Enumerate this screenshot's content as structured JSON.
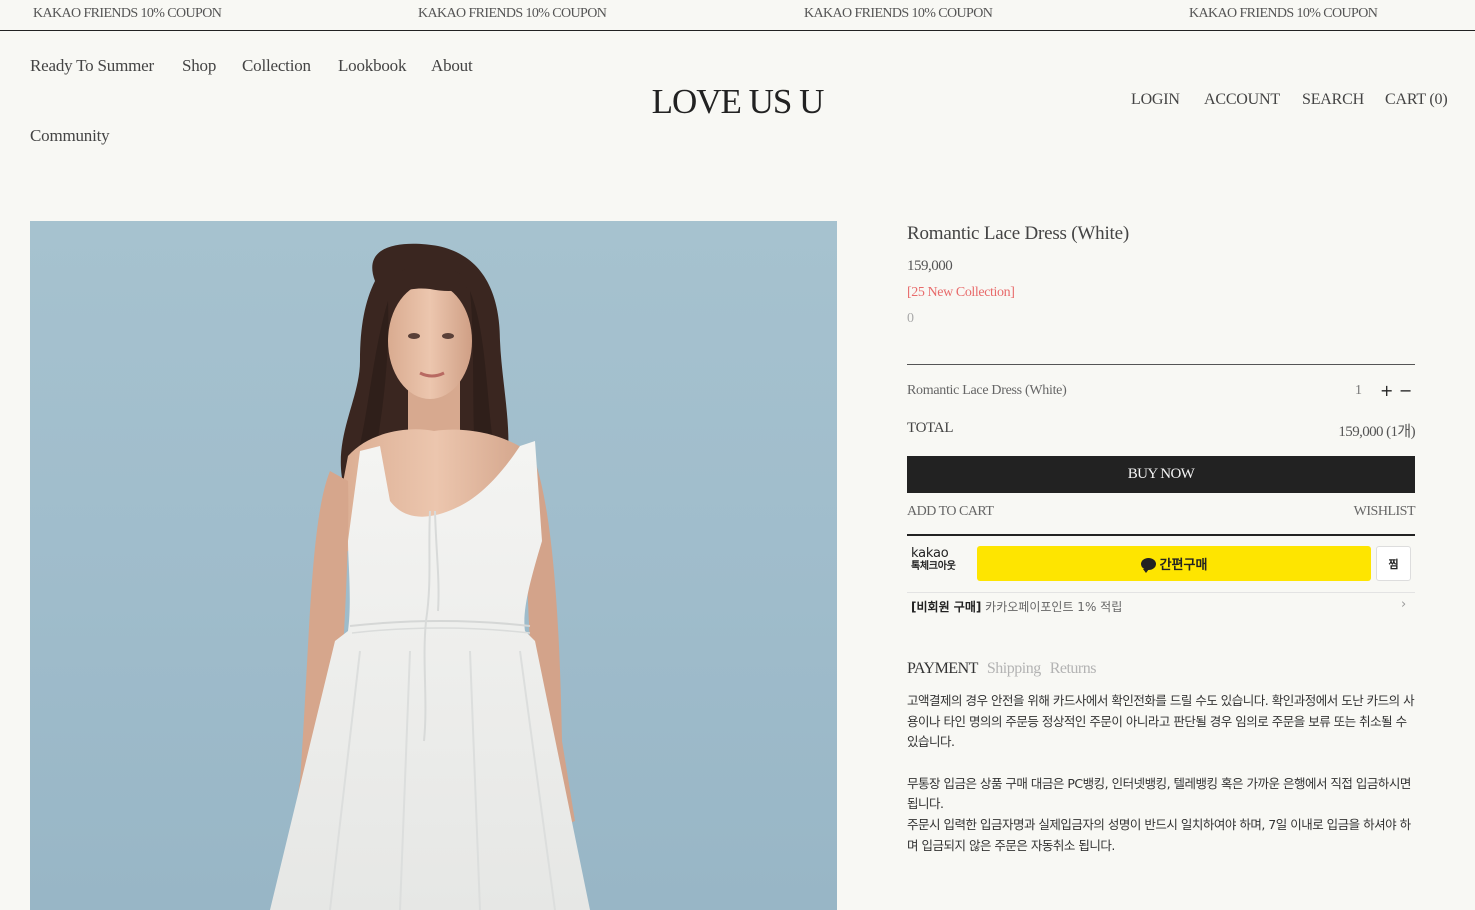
{
  "announcement": {
    "items": [
      "KAKAO FRIENDS 10% COUPON",
      "KAKAO FRIENDS 10% COUPON",
      "KAKAO FRIENDS 10% COUPON",
      "KAKAO FRIENDS 10% COUPON"
    ]
  },
  "nav": {
    "items": [
      "Ready To Summer",
      "Shop",
      "Collection",
      "Lookbook",
      "About",
      "Community"
    ]
  },
  "brand": {
    "logo": "LOVE US U"
  },
  "utility": {
    "login": "LOGIN",
    "account": "ACCOUNT",
    "search": "SEARCH",
    "cart": "CART (0)"
  },
  "product": {
    "title": "Romantic Lace Dress (White)",
    "price": "159,000",
    "badge": "[25 New Collection]",
    "reviews": "0",
    "image_icon": "model-photo",
    "option": {
      "name": "Romantic Lace Dress (White)",
      "qty": "1",
      "plus": "+",
      "minus": "−"
    },
    "total": {
      "label": "TOTAL",
      "value": "159,000 (1개)"
    },
    "buttons": {
      "buy_now": "BUY NOW",
      "add_to_cart": "ADD TO CART",
      "wishlist": "WISHLIST"
    }
  },
  "kakao": {
    "logo_top": "kakao",
    "logo_bottom": "톡체크아웃",
    "pay_label": "간편구매",
    "zzim": "찜",
    "member_bold": "[비회원 구매]",
    "member_text": " 카카오페이포인트 1% 적립",
    "chevron": "›",
    "accent_color": "#fee500"
  },
  "info_tabs": {
    "items": [
      "PAYMENT",
      "Shipping",
      "Returns"
    ],
    "active": 0
  },
  "payment_text": {
    "p1": "고액결제의 경우 안전을 위해 카드사에서 확인전화를 드릴 수도 있습니다. 확인과정에서 도난 카드의 사용이나 타인 명의의 주문등 정상적인 주문이 아니라고 판단될 경우 임의로 주문을 보류 또는 취소될 수 있습니다.",
    "p2": "무통장 입금은 상품 구매 대금은 PC뱅킹, 인터넷뱅킹, 텔레뱅킹 혹은 가까운 은행에서 직접 입금하시면 됩니다.",
    "p3": "주문시 입력한 입금자명과 실제입금자의 성명이 반드시 일치하여야 하며, 7일 이내로 입금을 하셔야 하며 입금되지 않은 주문은 자동취소 됩니다."
  }
}
